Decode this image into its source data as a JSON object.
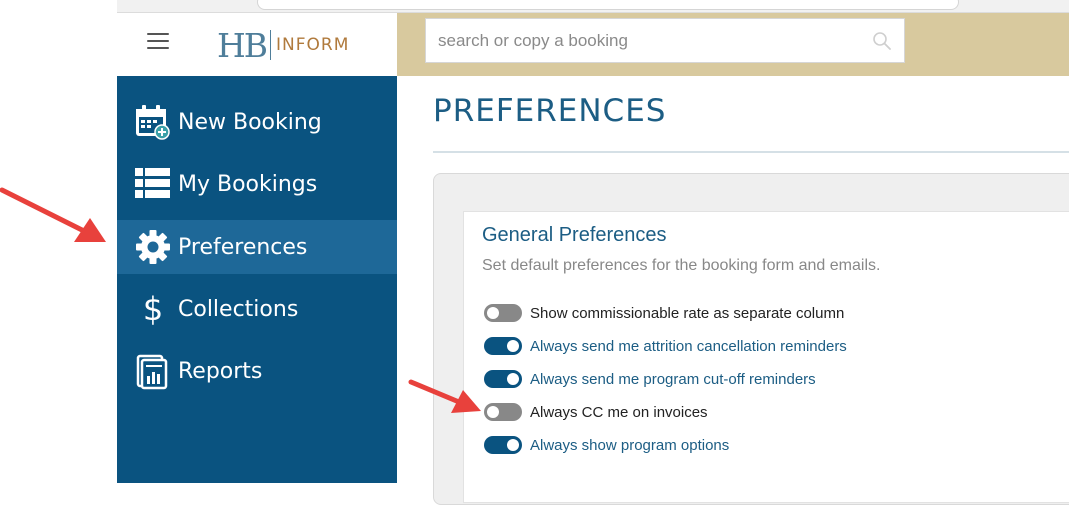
{
  "brand": {
    "logo_mark": "HB",
    "logo_word": "INFORM"
  },
  "search": {
    "placeholder": "search or copy a booking",
    "icon": "search-icon"
  },
  "sidebar": {
    "items": [
      {
        "label": "New Booking",
        "icon": "calendar-plus-icon",
        "active": false
      },
      {
        "label": "My Bookings",
        "icon": "list-icon",
        "active": false
      },
      {
        "label": "Preferences",
        "icon": "gear-icon",
        "active": true
      },
      {
        "label": "Collections",
        "icon": "dollar-icon",
        "active": false
      },
      {
        "label": "Reports",
        "icon": "report-icon",
        "active": false
      }
    ]
  },
  "main": {
    "title": "PREFERENCES",
    "card": {
      "title": "General Preferences",
      "subtitle": "Set default preferences for the booking form and emails.",
      "options": [
        {
          "label": "Show commissionable rate as separate column",
          "enabled": false
        },
        {
          "label": "Always send me attrition cancellation reminders",
          "enabled": true
        },
        {
          "label": "Always send me program cut-off reminders",
          "enabled": true
        },
        {
          "label": "Always CC me on invoices",
          "enabled": false
        },
        {
          "label": "Always show program options",
          "enabled": true
        }
      ]
    }
  },
  "colors": {
    "sidebar": "#0a5380",
    "sidebar_active": "#1e6898",
    "header_band": "#d8c99e",
    "accent": "#1c5d84",
    "toggle_on": "#0a5380",
    "toggle_off": "#888888",
    "annotation_arrow": "#e8413c"
  }
}
